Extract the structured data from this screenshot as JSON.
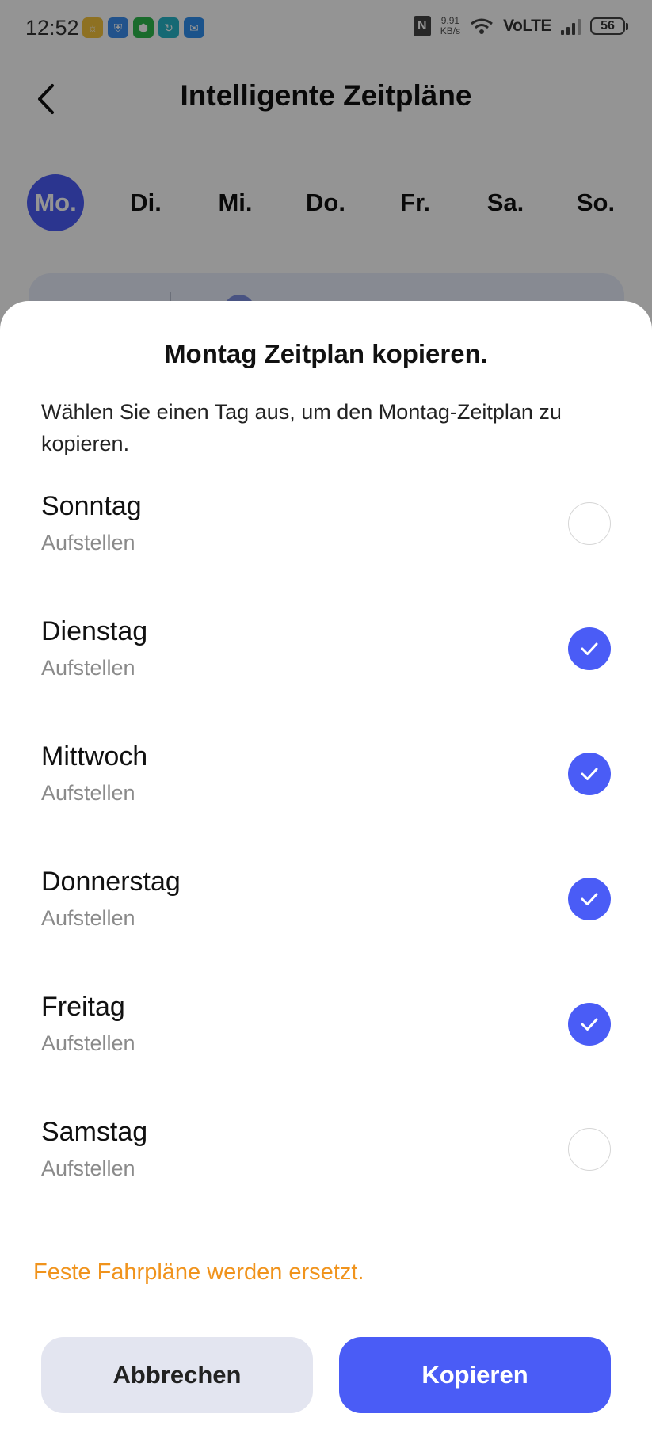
{
  "status_bar": {
    "time": "12:52",
    "net_speed_value": "9.91",
    "net_speed_unit": "KB/s",
    "network": "VoLTE",
    "battery": "56",
    "notification_icons": [
      {
        "name": "browser-app-icon",
        "color": "#f5c33b"
      },
      {
        "name": "vpn-app-icon",
        "color": "#3b8ef0"
      },
      {
        "name": "security-app-icon",
        "color": "#2db84c"
      },
      {
        "name": "sync-app-icon",
        "color": "#27b6c9"
      },
      {
        "name": "mail-app-icon",
        "color": "#2f8ff0"
      }
    ]
  },
  "header": {
    "title": "Intelligente Zeitpläne"
  },
  "day_tabs": [
    {
      "label": "Mo.",
      "active": true
    },
    {
      "label": "Di.",
      "active": false
    },
    {
      "label": "Mi.",
      "active": false
    },
    {
      "label": "Do.",
      "active": false
    },
    {
      "label": "Fr.",
      "active": false
    },
    {
      "label": "Sa.",
      "active": false
    },
    {
      "label": "So.",
      "active": false
    }
  ],
  "sheet": {
    "title": "Montag Zeitplan kopieren.",
    "description": "Wählen Sie einen Tag aus, um den Montag-Zeitplan zu kopieren.",
    "days": [
      {
        "name": "Sonntag",
        "subtitle": "Aufstellen",
        "checked": false
      },
      {
        "name": "Dienstag",
        "subtitle": "Aufstellen",
        "checked": true
      },
      {
        "name": "Mittwoch",
        "subtitle": "Aufstellen",
        "checked": true
      },
      {
        "name": "Donnerstag",
        "subtitle": "Aufstellen",
        "checked": true
      },
      {
        "name": "Freitag",
        "subtitle": "Aufstellen",
        "checked": true
      },
      {
        "name": "Samstag",
        "subtitle": "Aufstellen",
        "checked": false
      }
    ],
    "warning": "Feste Fahrpläne werden ersetzt.",
    "cancel_label": "Abbrechen",
    "copy_label": "Kopieren"
  },
  "colors": {
    "accent": "#4a5cf6",
    "warning": "#f0931c",
    "cancel_bg": "#e3e5f0"
  }
}
